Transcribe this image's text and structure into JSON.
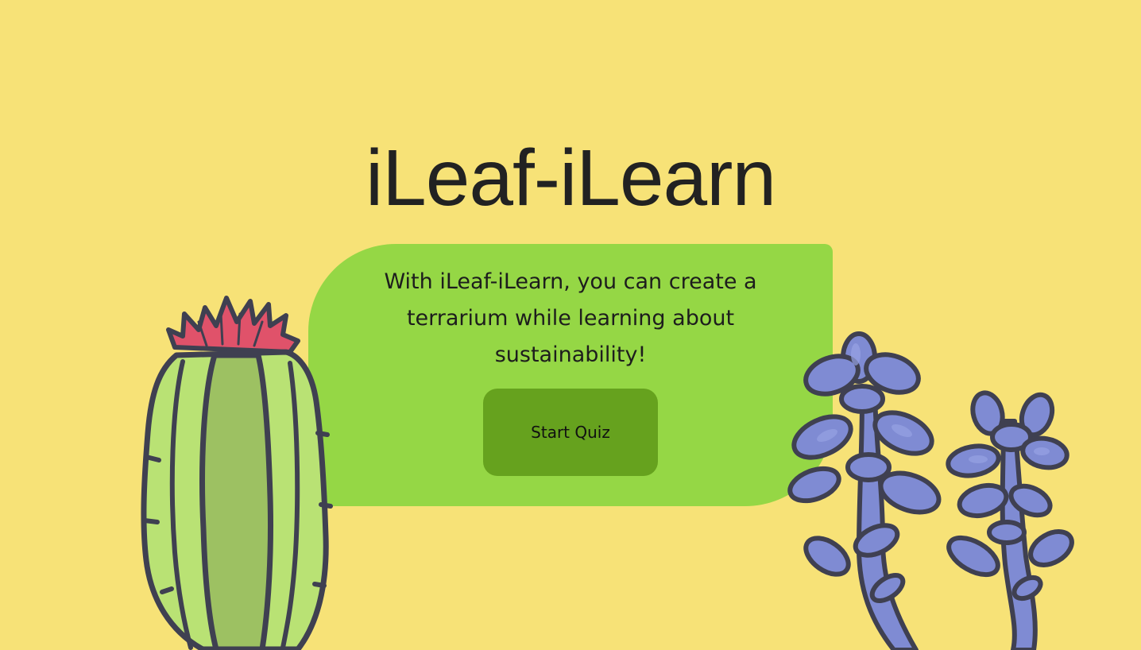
{
  "header": {
    "title": "iLeaf-iLearn"
  },
  "intro": {
    "text": "With iLeaf-iLearn, you can create a terrarium while learning about sustainability!",
    "button_label": "Start Quiz"
  },
  "illustrations": {
    "left": "cactus-icon",
    "right": "succulent-icon"
  },
  "colors": {
    "background": "#f7e277",
    "card": "#95d745",
    "button": "#66a21e",
    "cactus_light": "#b9e274",
    "cactus_dark": "#9dc162",
    "cactus_flower": "#e0526a",
    "succulent": "#7f8bd3",
    "outline": "#3f4051"
  }
}
